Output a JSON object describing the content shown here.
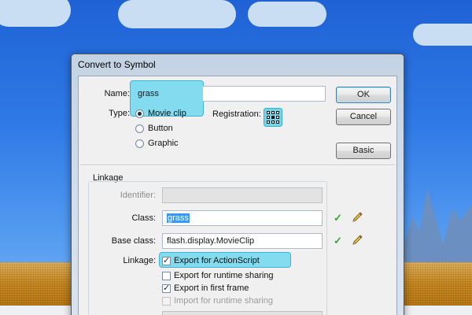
{
  "dialog": {
    "title": "Convert to Symbol",
    "name_label": "Name:",
    "name_value": "grass",
    "type_label": "Type:",
    "type_options": [
      "Movie clip",
      "Button",
      "Graphic"
    ],
    "type_selected": "Movie clip",
    "registration_label": "Registration:",
    "buttons": {
      "ok": "OK",
      "cancel": "Cancel",
      "basic": "Basic"
    }
  },
  "linkage": {
    "section_label": "Linkage",
    "identifier_label": "Identifier:",
    "identifier_value": "",
    "class_label": "Class:",
    "class_value": "grass",
    "base_class_label": "Base class:",
    "base_class_value": "flash.display.MovieClip",
    "linkage_label": "Linkage:",
    "options": [
      {
        "label": "Export for ActionScript",
        "checked": true,
        "enabled": true
      },
      {
        "label": "Export for runtime sharing",
        "checked": false,
        "enabled": true
      },
      {
        "label": "Export in first frame",
        "checked": true,
        "enabled": true
      },
      {
        "label": "Import for runtime sharing",
        "checked": false,
        "enabled": false
      }
    ]
  },
  "colors": {
    "highlight": "#6fd7ee",
    "sky": "#2f7ae6",
    "ground": "#c98a22",
    "selection": "#3399ff",
    "check": "#3aa23a"
  },
  "icons": [
    "registration-grid-icon",
    "check-icon",
    "pencil-icon"
  ]
}
